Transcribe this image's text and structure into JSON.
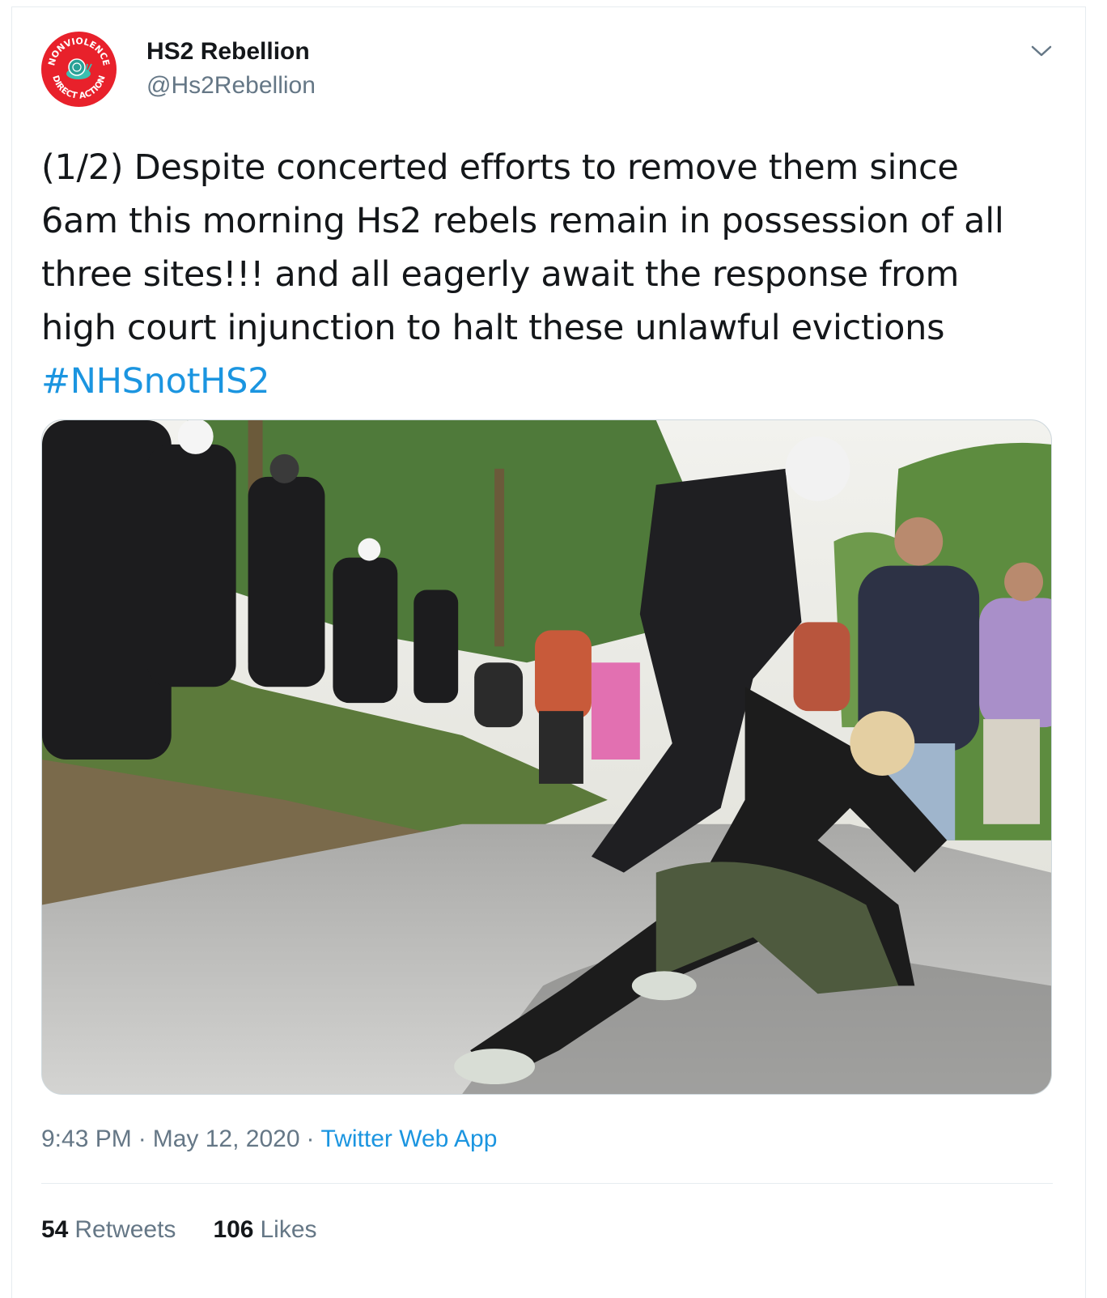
{
  "account": {
    "display_name": "HS2 Rebellion",
    "handle": "@Hs2Rebellion",
    "avatar_badge_top": "NONVIOLENCE",
    "avatar_badge_bottom": "DIRECT ACTION"
  },
  "tweet": {
    "text": "(1/2) Despite concerted efforts to remove them since\n6am this morning Hs2 rebels remain in possession of all\nthree sites!!! and all eagerly await the response from\nhigh court injunction to halt these unlawful evictions\n",
    "hashtag": "#NHSnotHS2"
  },
  "meta": {
    "time": "9:43 PM",
    "separator": "·",
    "date": "May 12, 2020",
    "source": "Twitter Web App"
  },
  "stats": {
    "retweets_count": "54",
    "retweets_label": "Retweets",
    "likes_count": "106",
    "likes_label": "Likes"
  },
  "icons": {
    "menu_caret": "chevron-down-icon"
  },
  "colors": {
    "link": "#1b95e0",
    "secondary_text": "#657786",
    "avatar_red": "#e8212b"
  }
}
